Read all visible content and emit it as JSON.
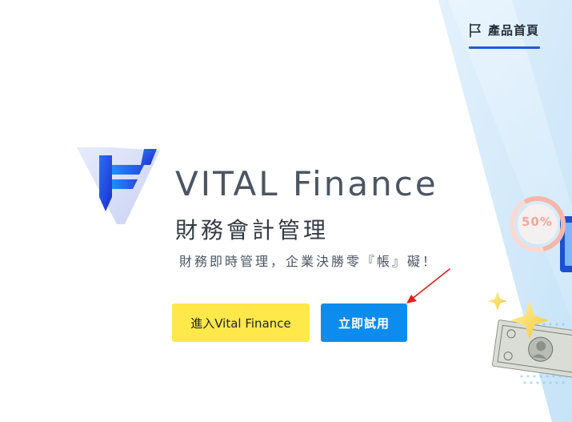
{
  "nav": {
    "home_tab_label": "產品首頁",
    "home_tab_icon": "flag-icon"
  },
  "brand": {
    "name": "VITAL Finance",
    "logo_icon": "vital-finance-logo"
  },
  "hero": {
    "title": "財務會計管理",
    "tagline": "財務即時管理，企業決勝零『帳』礙！"
  },
  "buttons": {
    "enter_label": "進入Vital Finance",
    "trial_label": "立即試用"
  },
  "decor": {
    "discount_badge": "50%"
  },
  "colors": {
    "accent_blue": "#0d8cf0",
    "accent_yellow": "#ffe84a",
    "nav_underline": "#1e5bd8",
    "arrow_red": "#e0201a"
  }
}
